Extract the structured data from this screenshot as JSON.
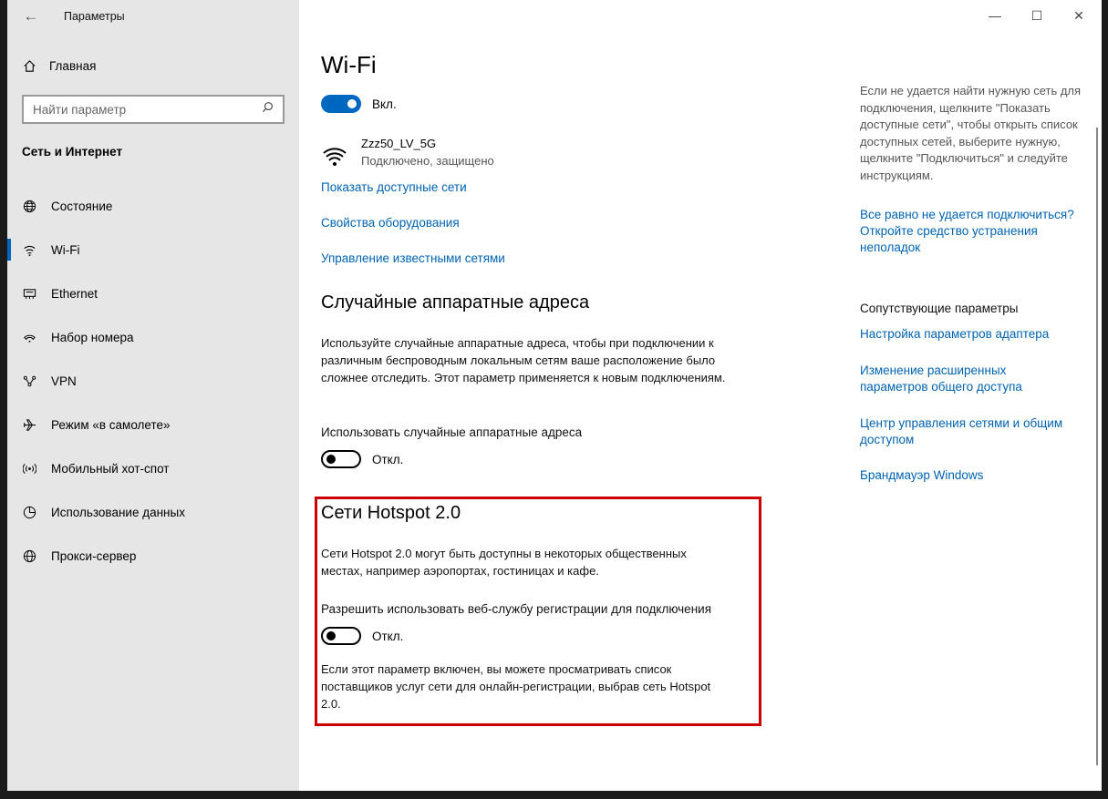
{
  "window": {
    "title": "Параметры",
    "back": "←",
    "controls": {
      "minimize": "—",
      "maximize": "☐",
      "close": "✕"
    }
  },
  "sidebar": {
    "home_label": "Главная",
    "search_placeholder": "Найти параметр",
    "section_title": "Сеть и Интернет",
    "items": [
      {
        "label": "Состояние",
        "icon": "globe-icon"
      },
      {
        "label": "Wi-Fi",
        "icon": "wifi-icon",
        "active": true
      },
      {
        "label": "Ethernet",
        "icon": "ethernet-icon"
      },
      {
        "label": "Набор номера",
        "icon": "dialup-icon"
      },
      {
        "label": "VPN",
        "icon": "vpn-icon"
      },
      {
        "label": "Режим «в самолете»",
        "icon": "airplane-icon"
      },
      {
        "label": "Мобильный хот-спот",
        "icon": "hotspot-icon"
      },
      {
        "label": "Использование данных",
        "icon": "data-usage-icon"
      },
      {
        "label": "Прокси-сервер",
        "icon": "globe-icon"
      }
    ]
  },
  "main": {
    "title": "Wi-Fi",
    "wifi_toggle_label": "Вкл.",
    "network": {
      "name": "Zzz50_LV_5G",
      "status": "Подключено, защищено"
    },
    "links": [
      "Показать доступные сети",
      "Свойства оборудования",
      "Управление известными сетями"
    ],
    "random_mac": {
      "heading": "Случайные аппаратные адреса",
      "description": "Используйте случайные аппаратные адреса, чтобы при подключении к различным беспроводным локальным сетям ваше расположение было сложнее отследить. Этот параметр применяется к новым подключениям.",
      "setting_label": "Использовать случайные аппаратные адреса",
      "toggle_label": "Откл."
    },
    "hotspot": {
      "heading": "Сети Hotspot 2.0",
      "description": "Сети Hotspot 2.0 могут быть доступны в некоторых общественных местах, например аэропортах, гостиницах и кафе.",
      "setting_label": "Разрешить использовать веб-службу регистрации для подключения",
      "toggle_label": "Откл.",
      "note": "Если этот параметр включен, вы можете просматривать список поставщиков услуг сети для онлайн-регистрации, выбрав сеть Hotspot 2.0."
    }
  },
  "right": {
    "help_text": "Если не удается найти нужную сеть для подключения, щелкните \"Показать доступные сети\", чтобы открыть список доступных сетей, выберите нужную, щелкните \"Подключиться\" и следуйте инструкциям.",
    "troubleshoot_link": "Все равно не удается подключиться? Откройте средство устранения неполадок",
    "related_heading": "Сопутствующие параметры",
    "related_links": [
      "Настройка параметров адаптера",
      "Изменение расширенных параметров общего доступа",
      "Центр управления сетями и общим доступом",
      "Брандмауэр Windows"
    ]
  },
  "colors": {
    "accent": "#0067c0",
    "link": "#0063b1",
    "sidebar_bg": "#e6e6e6",
    "highlight": "#cc0000"
  }
}
